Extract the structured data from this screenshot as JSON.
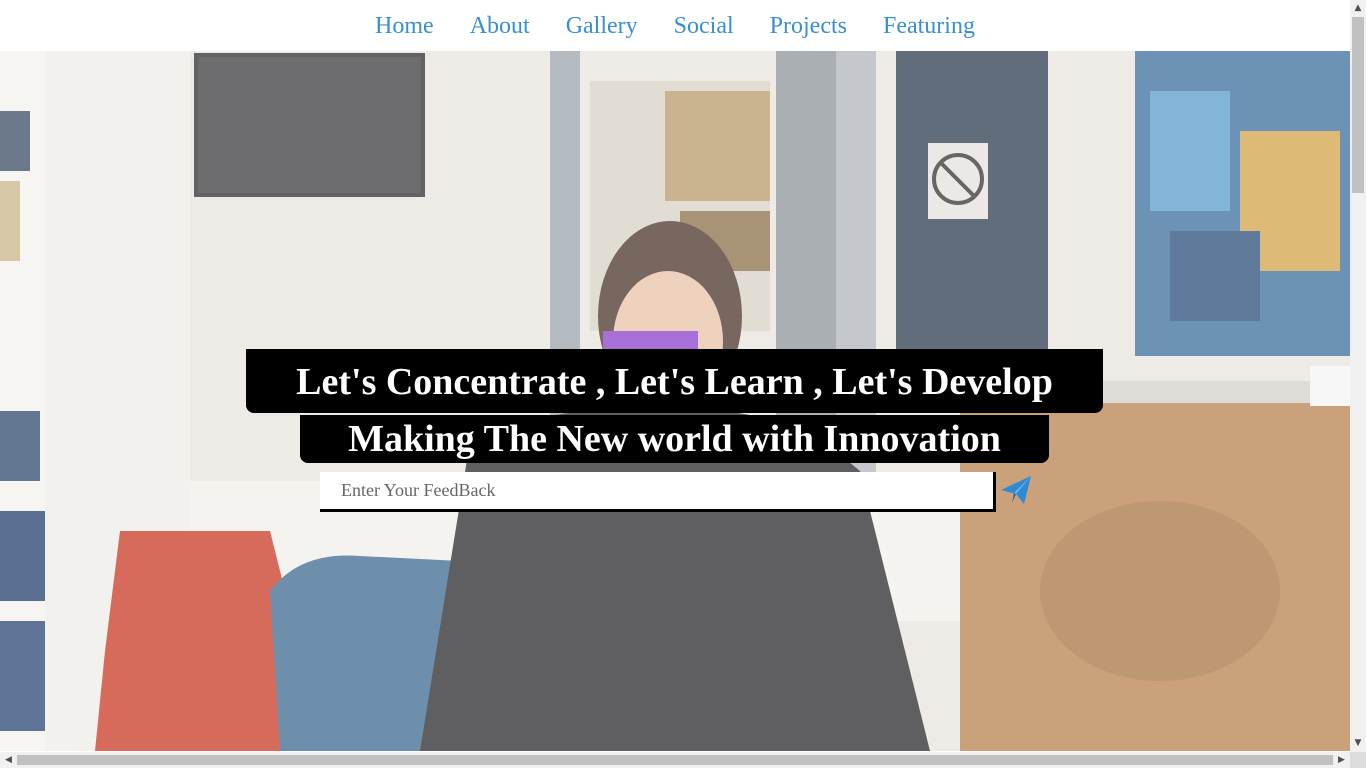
{
  "nav": {
    "items": [
      {
        "label": "Home"
      },
      {
        "label": "About"
      },
      {
        "label": "Gallery"
      },
      {
        "label": "Social"
      },
      {
        "label": "Projects"
      },
      {
        "label": "Featuring"
      }
    ]
  },
  "hero": {
    "tagline_1": "Let's Concentrate , Let's Learn , Let's Develop",
    "tagline_2": "Making The New world with Innovation",
    "feedback_placeholder": "Enter Your FeedBack",
    "send_icon": "paper-plane-icon"
  },
  "colors": {
    "nav_link": "#3a8fd0",
    "tagline_bg": "#000000",
    "tagline_text": "#ffffff",
    "send_icon": "#2f8ad6"
  }
}
